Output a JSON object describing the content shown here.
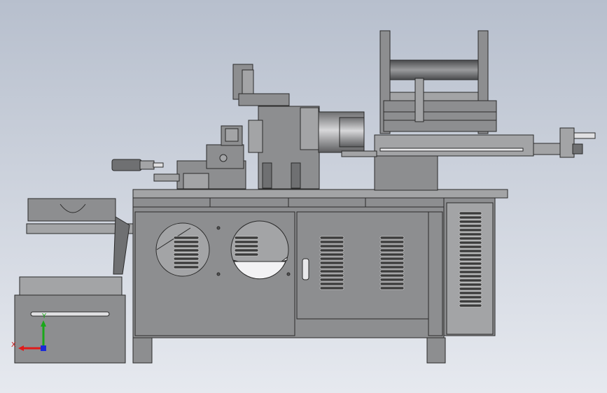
{
  "scene": {
    "background_top": "#b7bfcd",
    "background_bottom": "#e6e9ef",
    "body_color": "#8d8e90",
    "body_light": "#a3a4a6",
    "body_dark": "#6f7072",
    "edge_color": "#2a2a2a",
    "vent_color": "#3a3a3a",
    "vent_highlight": "#e8e8e8"
  },
  "triad": {
    "x_label": "X",
    "y_label": "Y",
    "x_color": "#e01a1a",
    "y_color": "#1aa81a",
    "z_color": "#1a2ad8",
    "label_color": "#c81a1a"
  }
}
